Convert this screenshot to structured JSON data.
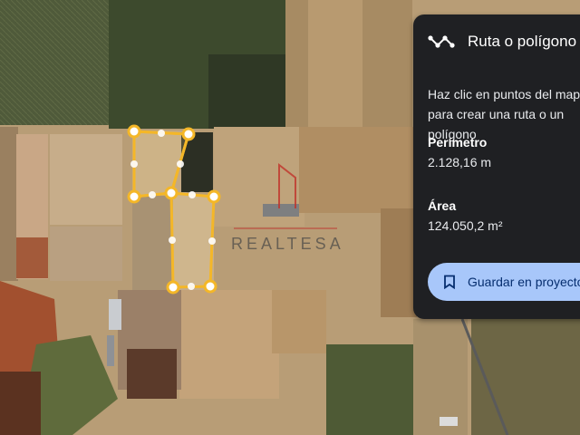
{
  "panel": {
    "title": "Ruta o polígono",
    "title_icon": "route-icon",
    "instructions": "Haz clic en puntos del mapa para crear una ruta o un polígono",
    "perimeter_label": "Perímetro",
    "perimeter_value": "2.128,16 m",
    "area_label": "Área",
    "area_value": "124.050,2 m²",
    "save_label": "Guardar en proyecto",
    "save_icon": "bookmark-icon"
  },
  "watermark": {
    "text": "REALTESA"
  },
  "colors": {
    "polygon_stroke": "#f4b728",
    "button_bg": "#a8c7fa",
    "panel_bg": "#1f2023"
  }
}
